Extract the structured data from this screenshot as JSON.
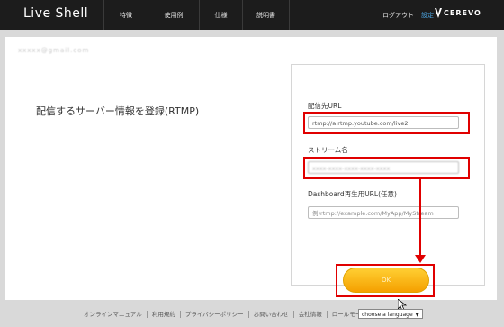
{
  "header": {
    "logo": "Live Shell",
    "nav": [
      "特徴",
      "使用例",
      "仕様",
      "説明書"
    ],
    "logout": "ログアウト",
    "settings": "設定",
    "brand": "CEREVO"
  },
  "account": {
    "email": "xxxxx@gmail.com"
  },
  "page": {
    "heading": "配信するサーバー情報を登録(RTMP)"
  },
  "form": {
    "url_label": "配信先URL",
    "url_value": "rtmp://a.rtmp.youtube.com/live2",
    "stream_label": "ストリーム名",
    "stream_value": "xxxx-xxxx-xxxx-xxxx-xxxx",
    "dashboard_label": "Dashboard再生用URL(任意)",
    "dashboard_placeholder": "例)rtmp://example.com/MyApp/MyStream",
    "ok_label": "OK"
  },
  "footer": {
    "links": [
      "オンラインマニュアル",
      "利用規約",
      "プライバシーポリシー",
      "お問い合わせ",
      "会社情報",
      "ロールモード"
    ],
    "language": "choose a language"
  },
  "colors": {
    "highlight": "#e00000",
    "accent": "#4aa3df",
    "button": "#f5a000"
  }
}
